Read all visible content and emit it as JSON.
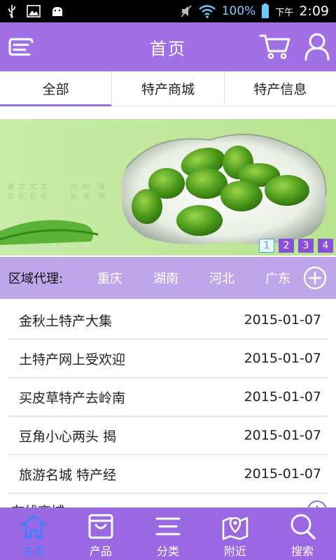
{
  "status_bar": {
    "battery_percent": "100%",
    "time_prefix": "下午",
    "time": "2:09"
  },
  "header": {
    "title": "首页"
  },
  "tabs": [
    {
      "label": "全部",
      "active": true
    },
    {
      "label": "特产商城",
      "active": false
    },
    {
      "label": "特产信息",
      "active": false
    }
  ],
  "banner": {
    "pages": [
      "1",
      "2",
      "3",
      "4"
    ],
    "active_page": 1
  },
  "region": {
    "label": "区域代理:",
    "items": [
      "重庆",
      "湖南",
      "河北",
      "广东"
    ]
  },
  "news": [
    {
      "title": "金秋土特产大集",
      "date": "2015-01-07"
    },
    {
      "title": "土特产网上受欢迎",
      "date": "2015-01-07"
    },
    {
      "title": "买皮草特产去岭南",
      "date": "2015-01-07"
    },
    {
      "title": "豆角小心两头 揭",
      "date": "2015-01-07"
    },
    {
      "title": "旅游名城 特产经",
      "date": "2015-01-07"
    }
  ],
  "next_section": {
    "title": "在线商城"
  },
  "bottom_nav": [
    {
      "label": "主页",
      "active": true
    },
    {
      "label": "产品",
      "active": false
    },
    {
      "label": "分类",
      "active": false
    },
    {
      "label": "附近",
      "active": false
    },
    {
      "label": "搜索",
      "active": false
    }
  ],
  "colors": {
    "primary_purple": "#a070e4",
    "region_bar": "#bfa5ea",
    "active_nav": "#3b82ff",
    "banner_green": "#bfe79a"
  }
}
